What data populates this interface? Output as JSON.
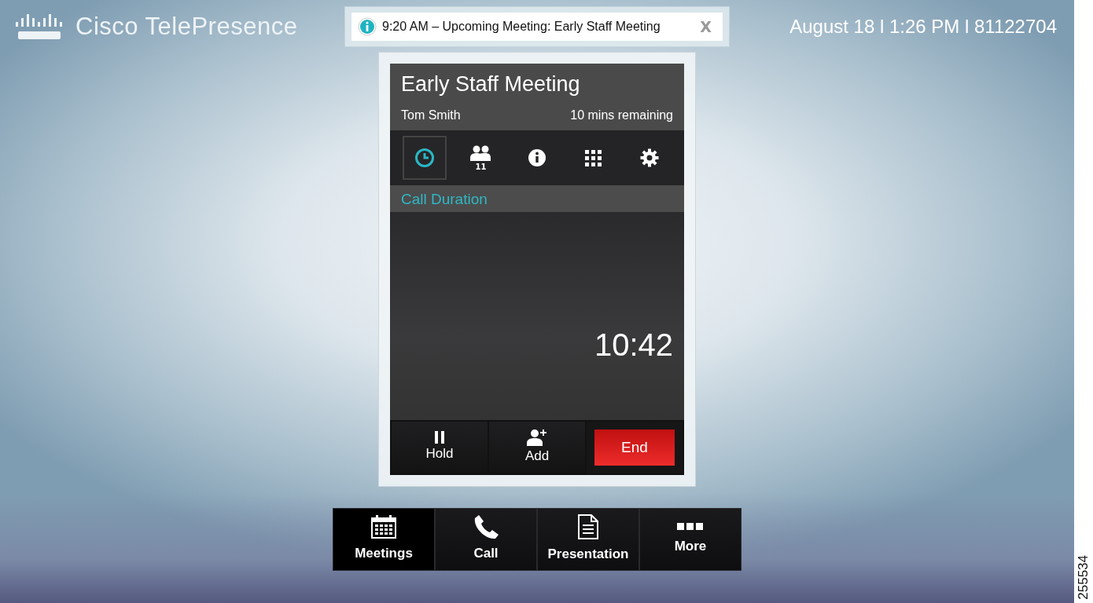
{
  "header": {
    "brand": "Cisco TelePresence",
    "status": "August 18 l 1:26 PM l 81122704"
  },
  "notification": {
    "text": "9:20 AM – Upcoming Meeting: Early Staff Meeting",
    "close": "X"
  },
  "call": {
    "title": "Early Staff Meeting",
    "caller": "Tom Smith",
    "remaining": "10 mins remaining",
    "tabs": [
      {
        "kind": "clock",
        "selected": true
      },
      {
        "kind": "participants",
        "selected": false,
        "count": "11"
      },
      {
        "kind": "info",
        "selected": false
      },
      {
        "kind": "keypad",
        "selected": false
      },
      {
        "kind": "settings",
        "selected": false
      }
    ],
    "section": "Call Duration",
    "duration": "10:42",
    "actions": [
      {
        "kind": "hold",
        "label": "Hold"
      },
      {
        "kind": "add",
        "label": "Add"
      },
      {
        "kind": "end",
        "label": "End"
      }
    ]
  },
  "dock": [
    {
      "kind": "meetings",
      "label": "Meetings",
      "selected": true
    },
    {
      "kind": "call",
      "label": "Call",
      "selected": false
    },
    {
      "kind": "presentation",
      "label": "Presentation",
      "selected": false
    },
    {
      "kind": "more",
      "label": "More",
      "selected": false
    }
  ],
  "figure_id": "255534"
}
